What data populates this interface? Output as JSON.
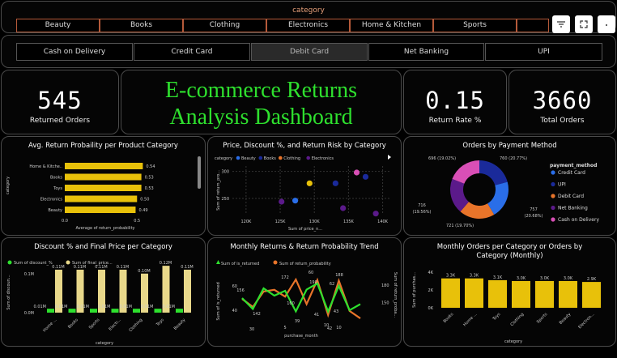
{
  "category_slicer": {
    "title": "category",
    "items": [
      "Beauty",
      "Books",
      "Clothing",
      "Electronics",
      "Home & Kitchen",
      "Sports"
    ]
  },
  "visual_header_icons": [
    "filter-icon",
    "focus-mode-icon",
    "more-options-icon"
  ],
  "payment_slicer": {
    "items": [
      "Cash on Delivery",
      "Credit Card",
      "Debit Card",
      "Net Banking",
      "UPI"
    ],
    "selected": "Debit Card"
  },
  "kpis": {
    "returned_orders": {
      "value": "545",
      "label": "Returned Orders"
    },
    "return_rate": {
      "value": "0.15",
      "label": "Return Rate %"
    },
    "total_orders": {
      "value": "3660",
      "label": "Total Orders"
    }
  },
  "dashboard_title": {
    "line1": "E-commerce Returns",
    "line2": "Analysis Dashboard"
  },
  "colors": {
    "gold": "#e8c10a",
    "green": "#2ee02e",
    "orange": "#e8742a",
    "purple": "#5b1a8a",
    "navy": "#1a2a9a",
    "pink": "#d94fb6"
  },
  "chart_data": [
    {
      "type": "bar",
      "title": "Avg. Return Probaility per Product Category",
      "orientation": "horizontal",
      "categories": [
        "Home & Kitchen",
        "Books",
        "Toys",
        "Electronics",
        "Beauty"
      ],
      "category_labels": [
        "Home & Kitche..",
        "Books",
        "Toys",
        "Electronics",
        "Beauty"
      ],
      "values": [
        0.54,
        0.53,
        0.53,
        0.5,
        0.49
      ],
      "value_labels": [
        "0.54",
        "0.53",
        "0.53",
        "0.50",
        "0.49"
      ],
      "xlabel": "Average of return_probability",
      "ylabel": "category",
      "xticks": [
        "0.0",
        "0.5"
      ],
      "xlim": [
        0,
        0.6
      ]
    },
    {
      "type": "scatter",
      "title": "Price, Discount %, and Return Risk by Category",
      "legend_title": "category",
      "legend": [
        "Beauty",
        "Books",
        "Clothing",
        "Electronics"
      ],
      "legend_colors": [
        "#2a6ee8",
        "#1a2a9a",
        "#e8742a",
        "#5b1a8a"
      ],
      "xlabel": "Sum of price_n...",
      "ylabel": "Sum of return_pro...",
      "xticks": [
        "120K",
        "125K",
        "130K",
        "135K",
        "140K"
      ],
      "yticks": [
        "300",
        "250"
      ],
      "points": [
        {
          "x": 125.2,
          "y": 244,
          "color": "#5b1a8a"
        },
        {
          "x": 127.2,
          "y": 246,
          "color": "#2a6ee8"
        },
        {
          "x": 129.3,
          "y": 278,
          "color": "#e8c10a"
        },
        {
          "x": 133.1,
          "y": 278,
          "color": "#1a2a9a"
        },
        {
          "x": 134.2,
          "y": 232,
          "color": "#5b1a8a"
        },
        {
          "x": 136.2,
          "y": 298,
          "color": "#d94fb6"
        },
        {
          "x": 137.5,
          "y": 290,
          "color": "#1a2a9a"
        },
        {
          "x": 139.0,
          "y": 222,
          "color": "#5b1a8a"
        }
      ],
      "xlim": [
        118,
        141
      ],
      "ylim": [
        220,
        310
      ]
    },
    {
      "type": "pie",
      "title": "Orders by Payment Method",
      "legend_title": "payment_method",
      "legend": [
        "Credit Card",
        "UPI",
        "Debit Card",
        "Net Banking",
        "Cash on Delivery"
      ],
      "slices": [
        {
          "label": "UPI",
          "value": 760,
          "text": "760 (20.77%)",
          "color": "#1a2a9a"
        },
        {
          "label": "Credit Card",
          "value": 757,
          "text": "757 (20.68%)",
          "color": "#2a6ee8"
        },
        {
          "label": "Debit Card",
          "value": 721,
          "text": "721 (19.70%)",
          "color": "#e8742a"
        },
        {
          "label": "Net Banking",
          "value": 716,
          "text": "716 (19.56%)",
          "color": "#5b1a8a"
        },
        {
          "label": "Cash on Delivery",
          "value": 696,
          "text": "696 (19.02%)",
          "color": "#d94fb6"
        }
      ]
    },
    {
      "type": "bar",
      "title": "Discount % and Final Price per Category",
      "legend": [
        "Sum of discount_%",
        "Sum of final_price..."
      ],
      "legend_colors": [
        "#2ee02e",
        "#e8d88a"
      ],
      "categories": [
        "Home ...",
        "Books",
        "Sports",
        "Electr...",
        "Clothing",
        "Toys",
        "Beauty"
      ],
      "series": [
        {
          "name": "Sum of discount_%",
          "values": [
            0.01,
            0.01,
            0.01,
            0.01,
            0.01,
            0.01,
            0.01
          ],
          "labels": [
            "0.01M",
            "0.01M",
            "0.01M",
            "0.01M",
            "0.01M",
            "0.01M",
            "0.01M"
          ]
        },
        {
          "name": "Sum of final_price",
          "values": [
            0.11,
            0.11,
            0.11,
            0.11,
            0.1,
            0.12,
            0.11
          ],
          "labels": [
            "0.11M",
            "0.11M",
            "0.11M",
            "0.11M",
            "0.10M",
            "0.12M",
            "0.11M"
          ]
        }
      ],
      "xlabel": "category",
      "ylabel": "Sum of discoun...",
      "yticks": [
        "0.1M",
        "0.0M"
      ],
      "ylim": [
        0,
        0.14
      ]
    },
    {
      "type": "line",
      "title": "Monthly Returns & Return Probability Trend",
      "legend": [
        "Sum of is_returned",
        "Sum of return_probability"
      ],
      "legend_colors": [
        "#2ee02e",
        "#e8742a"
      ],
      "x": [
        1,
        2,
        3,
        4,
        5,
        6,
        7,
        8,
        9,
        10,
        11,
        12
      ],
      "series": [
        {
          "name": "Sum of is_returned",
          "values": [
            50,
            41,
            58,
            52,
            56,
            39,
            57,
            62,
            39,
            60,
            40,
            45
          ]
        },
        {
          "name": "Sum of return_probability",
          "values": [
            156,
            142,
            169,
            172,
            160,
            190,
            147,
            189,
            128,
            188,
            135,
            122
          ]
        }
      ],
      "data_labels": [
        "156",
        "172",
        "60",
        "190",
        "188",
        "30",
        "142",
        "160",
        "39",
        "41",
        "42",
        "10",
        "43",
        "62"
      ],
      "xlabel": "purchase_month",
      "ylabel": "Sum of is_returned",
      "y2label": "Sum of return_proba...",
      "yticks": [
        "60",
        "40"
      ],
      "y2ticks": [
        "180",
        "150"
      ],
      "xticks": [
        "5",
        "10"
      ]
    },
    {
      "type": "bar",
      "title": "Monthly Orders per Category or Orders by Category (Monthly)",
      "categories": [
        "Books",
        "Home ...",
        "Toys",
        "Clothing",
        "Sports",
        "Beauty",
        "Electron..."
      ],
      "values": [
        3.3,
        3.3,
        3.1,
        3.0,
        3.0,
        3.0,
        2.9
      ],
      "value_labels": [
        "3.3K",
        "3.3K",
        "3.1K",
        "3.0K",
        "3.0K",
        "3.0K",
        "2.9K"
      ],
      "xlabel": "category",
      "ylabel": "Sum of purchas...",
      "yticks": [
        "4K",
        "2K",
        "0K"
      ],
      "ylim": [
        0,
        4
      ]
    }
  ]
}
